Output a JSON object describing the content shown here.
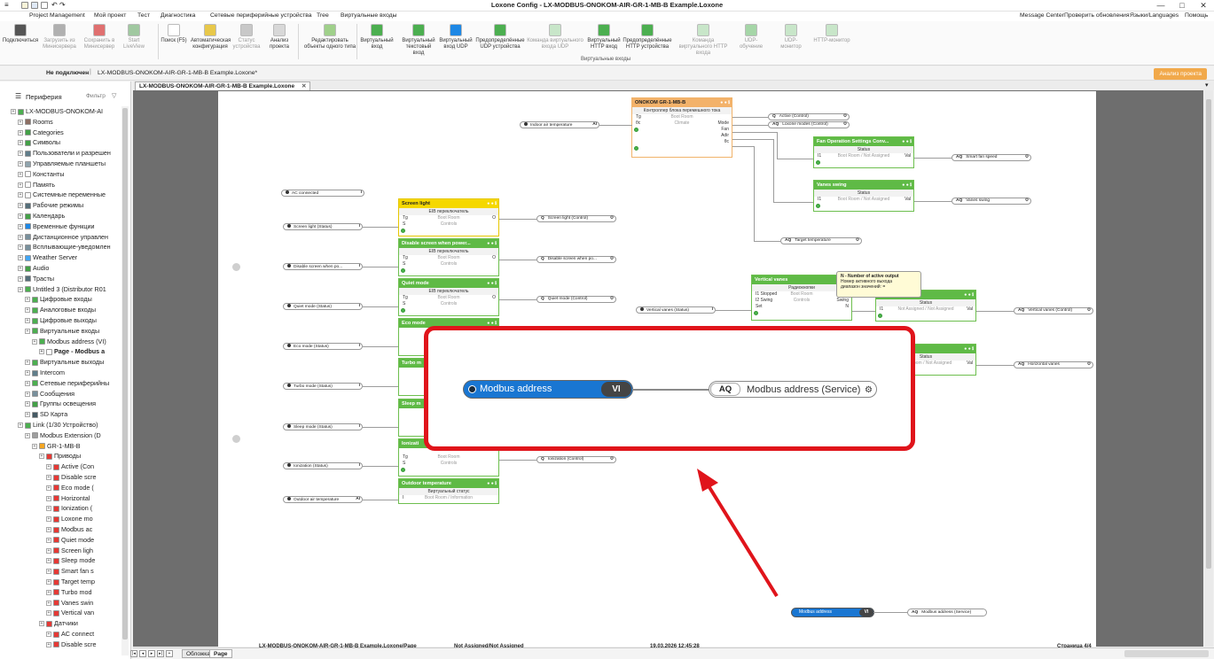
{
  "window": {
    "title": "Loxone Config - LX-MODBUS-ONOKOM-AIR-GR-1-MB-B Example.Loxone",
    "controls": [
      "—",
      "□",
      "✕"
    ]
  },
  "menu": {
    "left": [
      "Project Management",
      "Мой проект",
      "Тест",
      "Диагностика",
      "Сетевые периферийные устройства",
      "Tree",
      "Виртуальные входы"
    ],
    "right": [
      "Message Center",
      "Проверить обновления",
      "Языки/Languages",
      "Помощь"
    ]
  },
  "ribbon": {
    "buttons": [
      {
        "label": "Подключиться",
        "color": "#555555",
        "enabled": true
      },
      {
        "label": "Загрузить из Минисервера",
        "color": "#b0b0b0",
        "enabled": false
      },
      {
        "label": "Сохранить в Минисервер",
        "color": "#e07070",
        "enabled": false
      },
      {
        "label": "Start LiveView",
        "color": "#a0c8a0",
        "enabled": false
      },
      {
        "label": "Поиск (F5)",
        "color": "#ffffff",
        "enabled": true
      },
      {
        "label": "Автоматическая конфигурация",
        "color": "#e8c84a",
        "enabled": true
      },
      {
        "label": "Статус устройства",
        "color": "#c8c8c8",
        "enabled": false
      },
      {
        "label": "Анализ проекта",
        "color": "#d8d8d8",
        "enabled": true
      },
      {
        "label": "Редактировать объекты одного типа",
        "color": "#9fd08a",
        "enabled": true
      },
      {
        "label": "Виртуальный вход",
        "color": "#4caf50",
        "enabled": true
      },
      {
        "label": "Виртуальный текстовый вход",
        "color": "#4caf50",
        "enabled": true
      },
      {
        "label": "Виртуальный вход UDP",
        "color": "#1e88e5",
        "enabled": true
      },
      {
        "label": "Предопределённые UDP устройства",
        "color": "#4caf50",
        "enabled": true
      },
      {
        "label": "Команда виртуального входа UDP",
        "color": "#c8e6c9",
        "enabled": false
      },
      {
        "label": "Виртуальный HTTP вход",
        "color": "#4caf50",
        "enabled": true
      },
      {
        "label": "Предопределённые HTTP устройства",
        "color": "#4caf50",
        "enabled": true
      },
      {
        "label": "Команда виртуального HTTP входа",
        "color": "#c8e6c9",
        "enabled": false
      },
      {
        "label": "UDP-обучение",
        "color": "#a5d6a7",
        "enabled": false
      },
      {
        "label": "UDP-монитор",
        "color": "#c8e6c9",
        "enabled": false
      },
      {
        "label": "HTTP-монитор",
        "color": "#c8e6c9",
        "enabled": false
      }
    ],
    "group_label": "Виртуальные входы"
  },
  "statusbar": {
    "connection": "Не подключен",
    "file": "LX-MODBUS-ONOKOM-AIR-GR-1-MB-B Example.Loxone*",
    "analyse": "Анализ проекта"
  },
  "leftpanel": {
    "title": "Периферия",
    "filter": "Фильтр",
    "items": [
      {
        "label": "LX-MODBUS-ONOKOM-AI",
        "indent": 0,
        "color": "#4caf50"
      },
      {
        "label": "Rooms",
        "indent": 1,
        "color": "#8d6e63"
      },
      {
        "label": "Categories",
        "indent": 1,
        "color": "#43a047"
      },
      {
        "label": "Символы",
        "indent": 1,
        "color": "#43a047"
      },
      {
        "label": "Пользователи и разрешен",
        "indent": 1,
        "color": "#607d8b"
      },
      {
        "label": "Управляемые планшеты",
        "indent": 1,
        "color": "#90a4ae"
      },
      {
        "label": "Константы",
        "indent": 1,
        "color": "#ffffff"
      },
      {
        "label": "Память",
        "indent": 1,
        "color": "#ffffff"
      },
      {
        "label": "Системные переменные",
        "indent": 1,
        "color": "#ffffff"
      },
      {
        "label": "Рабочие режимы",
        "indent": 1,
        "color": "#546e7a"
      },
      {
        "label": "Календарь",
        "indent": 1,
        "color": "#43a047"
      },
      {
        "label": "Временные функции",
        "indent": 1,
        "color": "#1e88e5"
      },
      {
        "label": "Дистанционное управлен",
        "indent": 1,
        "color": "#78909c"
      },
      {
        "label": "Всплывающие-уведомлен",
        "indent": 1,
        "color": "#78909c"
      },
      {
        "label": "Weather Server",
        "indent": 1,
        "color": "#42a5f5"
      },
      {
        "label": "Audio",
        "indent": 1,
        "color": "#43a047"
      },
      {
        "label": "Трасты",
        "indent": 1,
        "color": "#546e7a"
      },
      {
        "label": "Untitled 3 (Distributor R01",
        "indent": 1,
        "color": "#4caf50"
      },
      {
        "label": "Цифровые входы",
        "indent": 2,
        "color": "#4caf50"
      },
      {
        "label": "Аналоговые входы",
        "indent": 2,
        "color": "#4caf50"
      },
      {
        "label": "Цифровые выходы",
        "indent": 2,
        "color": "#4caf50"
      },
      {
        "label": "Виртуальные входы",
        "indent": 2,
        "color": "#4caf50"
      },
      {
        "label": "Modbus address (VI)",
        "indent": 3,
        "color": "#4caf50"
      },
      {
        "label": "Page - Modbus a",
        "indent": 4,
        "color": "#ffffff",
        "bold": true
      },
      {
        "label": "Виртуальные выходы",
        "indent": 2,
        "color": "#4caf50"
      },
      {
        "label": "Intercom",
        "indent": 2,
        "color": "#607d8b"
      },
      {
        "label": "Сетевые периферийны",
        "indent": 2,
        "color": "#4caf50"
      },
      {
        "label": "Сообщения",
        "indent": 2,
        "color": "#78909c"
      },
      {
        "label": "Группы освещения",
        "indent": 2,
        "color": "#43a047"
      },
      {
        "label": "SD Карта",
        "indent": 2,
        "color": "#455a64"
      },
      {
        "label": "Link (1/30 Устройство)",
        "indent": 1,
        "color": "#4caf50"
      },
      {
        "label": "Modbus Extension (D",
        "indent": 2,
        "color": "#9e9e9e"
      },
      {
        "label": "GR-1-MB-B",
        "indent": 3,
        "color": "#f5a623"
      },
      {
        "label": "Приводы",
        "indent": 4,
        "color": "#e53935"
      },
      {
        "label": "Active (Con",
        "indent": 5,
        "color": "#e53935"
      },
      {
        "label": "Disable scre",
        "indent": 5,
        "color": "#e53935"
      },
      {
        "label": "Eco mode (",
        "indent": 5,
        "color": "#e53935"
      },
      {
        "label": "Horizontal",
        "indent": 5,
        "color": "#e53935"
      },
      {
        "label": "Ionization (",
        "indent": 5,
        "color": "#e53935"
      },
      {
        "label": "Loxone mo",
        "indent": 5,
        "color": "#e53935"
      },
      {
        "label": "Modbus ac",
        "indent": 5,
        "color": "#e53935"
      },
      {
        "label": "Quiet mode",
        "indent": 5,
        "color": "#e53935"
      },
      {
        "label": "Screen ligh",
        "indent": 5,
        "color": "#e53935"
      },
      {
        "label": "Sleep mode",
        "indent": 5,
        "color": "#e53935"
      },
      {
        "label": "Smart fan s",
        "indent": 5,
        "color": "#e53935"
      },
      {
        "label": "Target temp",
        "indent": 5,
        "color": "#e53935"
      },
      {
        "label": "Turbo mod",
        "indent": 5,
        "color": "#e53935"
      },
      {
        "label": "Vanes swin",
        "indent": 5,
        "color": "#e53935"
      },
      {
        "label": "Vertical van",
        "indent": 5,
        "color": "#e53935"
      },
      {
        "label": "Датчики",
        "indent": 4,
        "color": "#e53935"
      },
      {
        "label": "AC connect",
        "indent": 5,
        "color": "#e53935"
      },
      {
        "label": "Disable scre",
        "indent": 5,
        "color": "#e53935"
      }
    ]
  },
  "doc": {
    "tab": "LX-MODBUS-ONOKOM-AIR-GR-1-MB-B Example.Loxone",
    "sheets": [
      "Обложка",
      "Page"
    ],
    "footer": {
      "left": "LX-MODBUS-ONOKOM-AIR-GR-1-MB-B Example.Loxone/Page",
      "mid": "Not Assigned/Not Assigned",
      "date": "19.03.2026 12:45:28",
      "page": "Страница 4/4"
    }
  },
  "diagram": {
    "onokom": {
      "title": "ONOKOM GR-1-MB-B",
      "subtitle": "Контроллер блока перемешного тока",
      "in1": "Tg",
      "in2": "θc",
      "room": "Boot Room",
      "cat": "Climate",
      "outs": [
        "Status",
        "Mode",
        "Fan",
        "Adir",
        "θc"
      ]
    },
    "fan_block": {
      "title": "Fan Operation Settings Conv...",
      "status": "Status",
      "in": "I1",
      "out": "Val",
      "assign": "Boot Room / Not Assigned"
    },
    "vanes_block": {
      "title": "Vanes swing",
      "status": "Status",
      "in": "I1",
      "out": "Val",
      "assign": "Boot Room / Not Assigned"
    },
    "screen_block": {
      "title": "Screen light",
      "type": "EIB переключатель",
      "in1": "Tg",
      "in2": "S",
      "room": "Boot Room",
      "cat": "Controls",
      "out": "O"
    },
    "disable_block": {
      "title": "Disable screen when power...",
      "type": "EIB переключатель",
      "in1": "Tg",
      "in2": "S",
      "room": "Boot Room",
      "cat": "Controls",
      "out": "O"
    },
    "quiet_block": {
      "title": "Quiet mode",
      "type": "EIB переключатель",
      "in1": "Tg",
      "in2": "S",
      "room": "Boot Room",
      "cat": "Controls",
      "out": "O"
    },
    "eco_block": {
      "title": "Eco mode"
    },
    "turbo_block": {
      "title": "Turbo m"
    },
    "sleep_block": {
      "title": "Sleep m"
    },
    "ion_block": {
      "title": "Ionizati",
      "in1": "Tg",
      "in2": "S",
      "room": "Boot Room",
      "cat": "Controls"
    },
    "outdoor_block": {
      "title": "Outdoor temperature",
      "type": "Виртуальный статус",
      "in": "I",
      "assign": "Boot Room / Information"
    },
    "vertical_block": {
      "title": "Vertical vanes",
      "type": "Радиокнопки",
      "in1": "I1 Stopped",
      "in2": "I2 Swing",
      "in3": "Set",
      "room": "Boot Room",
      "cat": "Controls",
      "out1": "Stopp",
      "out2": "Swing",
      "out3": "N"
    },
    "vert_status_block": {
      "status": "Status",
      "in": "I1",
      "out": "Val",
      "assign": "Not Assigned / Not Assigned"
    },
    "horiz_status_block": {
      "status": "Status",
      "in": "I1",
      "out": "Val",
      "assign": "Boot Room / Not Assigned"
    },
    "inputs": [
      {
        "label": "Indoor air temperature",
        "tag": "AI"
      },
      {
        "label": "AC connected",
        "tag": "I"
      },
      {
        "label": "Screen light (Status)",
        "tag": "I"
      },
      {
        "label": "Disable screen when po...",
        "tag": "I"
      },
      {
        "label": "Quiet mode (Status)",
        "tag": "I"
      },
      {
        "label": "Eco mode (Status)",
        "tag": "I"
      },
      {
        "label": "Turbo mode (Status)",
        "tag": "I"
      },
      {
        "label": "Sleep mode (Status)",
        "tag": "I"
      },
      {
        "label": "Ionization (Status)",
        "tag": "I"
      },
      {
        "label": "Outdoor air temperature",
        "tag": "AI"
      },
      {
        "label": "Vertical vanes (Status)",
        "tag": "I"
      }
    ],
    "outputs": [
      {
        "tag": "Q",
        "label": "Active (Control)"
      },
      {
        "tag": "AQ",
        "label": "Loxone modes (Control)"
      },
      {
        "tag": "AQ",
        "label": "Smart fan speed"
      },
      {
        "tag": "AQ",
        "label": "Vanes swing"
      },
      {
        "tag": "AQ",
        "label": "Target temperature"
      },
      {
        "tag": "Q",
        "label": "Screen light (Control)"
      },
      {
        "tag": "Q",
        "label": "Disable screen when po..."
      },
      {
        "tag": "Q",
        "label": "Quiet mode (Control)"
      },
      {
        "tag": "Q",
        "label": "Ionization (Control)"
      },
      {
        "tag": "AQ",
        "label": "Vertical vanes (Control)"
      },
      {
        "tag": "AQ",
        "label": "Horizontal vanes"
      }
    ],
    "small_vi": {
      "label": "Modbus address",
      "tag": "VI"
    },
    "small_aq": {
      "tag": "AQ",
      "label": "Modbus address (Service)"
    },
    "zoom": {
      "vi_label": "Modbus address",
      "vi_tag": "VI",
      "aq_tag": "AQ",
      "aq_label": "Modbus address (Service)"
    },
    "tooltip": {
      "title": "N - Number of active output",
      "line1": "Номер активного выхода",
      "line2": "диапазон значений: ="
    }
  }
}
